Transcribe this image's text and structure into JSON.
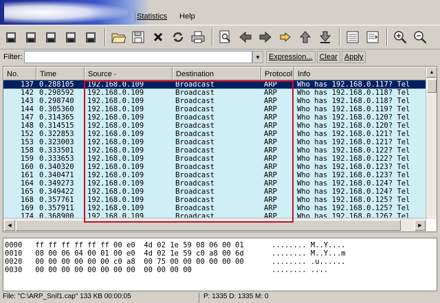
{
  "menu": [
    "Statistics",
    "Help"
  ],
  "toolbar": {
    "icons": [
      "disk-icon",
      "disk-icon",
      "disk-icon",
      "disk-icon",
      "disk-icon",
      "folder-open-icon",
      "save-icon",
      "close-icon",
      "reload-icon",
      "print-icon",
      "find-icon",
      "back-arrow-icon",
      "forward-arrow-icon",
      "goto-icon",
      "top-icon",
      "bottom-icon",
      "colorize-icon",
      "autoscroll-icon",
      "zoom-in-icon",
      "zoom-out-icon"
    ]
  },
  "filter": {
    "label": "Filter:",
    "value": "",
    "expression_label": "Expression...",
    "clear_label": "Clear",
    "apply_label": "Apply"
  },
  "packet_list": {
    "columns": [
      "No.",
      "Time",
      "Source",
      "Destination",
      "Protocol",
      "Info"
    ],
    "sort_indicator": "-",
    "rows": [
      {
        "no": "137",
        "time": "0.288105",
        "src": "192.168.0.109",
        "dst": "Broadcast",
        "proto": "ARP",
        "info": "Who has 192.168.0.117?  Tel",
        "selected": true
      },
      {
        "no": "142",
        "time": "0.298592",
        "src": "192.168.0.109",
        "dst": "Broadcast",
        "proto": "ARP",
        "info": "Who has 192.168.0.118?  Tel"
      },
      {
        "no": "143",
        "time": "0.298740",
        "src": "192.168.0.109",
        "dst": "Broadcast",
        "proto": "ARP",
        "info": "Who has 192.168.0.118?  Tel"
      },
      {
        "no": "144",
        "time": "0.305360",
        "src": "192.168.0.109",
        "dst": "Broadcast",
        "proto": "ARP",
        "info": "Who has 192.168.0.119?  Tel"
      },
      {
        "no": "147",
        "time": "0.314365",
        "src": "192.168.0.109",
        "dst": "Broadcast",
        "proto": "ARP",
        "info": "Who has 192.168.0.120?  Tel"
      },
      {
        "no": "148",
        "time": "0.314515",
        "src": "192.168.0.109",
        "dst": "Broadcast",
        "proto": "ARP",
        "info": "Who has 192.168.0.120?  Tel"
      },
      {
        "no": "152",
        "time": "0.322853",
        "src": "192.168.0.109",
        "dst": "Broadcast",
        "proto": "ARP",
        "info": "Who has 192.168.0.121?  Tel"
      },
      {
        "no": "153",
        "time": "0.323003",
        "src": "192.168.0.109",
        "dst": "Broadcast",
        "proto": "ARP",
        "info": "Who has 192.168.0.121?  Tel"
      },
      {
        "no": "158",
        "time": "0.333501",
        "src": "192.168.0.109",
        "dst": "Broadcast",
        "proto": "ARP",
        "info": "Who has 192.168.0.122?  Tel"
      },
      {
        "no": "159",
        "time": "0.333653",
        "src": "192.168.0.109",
        "dst": "Broadcast",
        "proto": "ARP",
        "info": "Who has 192.168.0.122?  Tel"
      },
      {
        "no": "160",
        "time": "0.340320",
        "src": "192.168.0.109",
        "dst": "Broadcast",
        "proto": "ARP",
        "info": "Who has 192.168.0.123?  Tel"
      },
      {
        "no": "161",
        "time": "0.340471",
        "src": "192.168.0.109",
        "dst": "Broadcast",
        "proto": "ARP",
        "info": "Who has 192.168.0.123?  Tel"
      },
      {
        "no": "164",
        "time": "0.349273",
        "src": "192.168.0.109",
        "dst": "Broadcast",
        "proto": "ARP",
        "info": "Who has 192.168.0.124?  Tel"
      },
      {
        "no": "165",
        "time": "0.349422",
        "src": "192.168.0.109",
        "dst": "Broadcast",
        "proto": "ARP",
        "info": "Who has 192.168.0.124?  Tel"
      },
      {
        "no": "168",
        "time": "0.357761",
        "src": "192.168.0.109",
        "dst": "Broadcast",
        "proto": "ARP",
        "info": "Who has 192.168.0.125?  Tel"
      },
      {
        "no": "169",
        "time": "0.357911",
        "src": "192.168.0.109",
        "dst": "Broadcast",
        "proto": "ARP",
        "info": "Who has 192.168.0.125?  Tel"
      },
      {
        "no": "174",
        "time": "0.368900",
        "src": "192.168.0.109",
        "dst": "Broadcast",
        "proto": "ARP",
        "info": "Who has 192.168.0.126?  Tel"
      }
    ]
  },
  "bytes_pane": {
    "lines": [
      {
        "offset": "0000",
        "hex": "ff ff ff ff ff ff 00 e0  4d 02 1e 59 08 06 00 01",
        "ascii": "........ M..Y...."
      },
      {
        "offset": "0010",
        "hex": "08 00 06 04 00 01 00 e0  4d 02 1e 59 c0 a8 00 6d",
        "ascii": "........ M..Y...m"
      },
      {
        "offset": "0020",
        "hex": "00 00 00 00 00 00 c0 a8  00 75 00 00 00 00 00 00",
        "ascii": "........ .u......"
      },
      {
        "offset": "0030",
        "hex": "00 00 00 00 00 00 00 00  00 00 00 00",
        "ascii": "........ ...."
      }
    ]
  },
  "status": {
    "file": "File: \"C:\\ARP_Snif1.cap\" 133 KB 00:00:05",
    "packets": "P: 1335 D: 1335 M: 0"
  },
  "colors": {
    "row_background": "#cfeef6",
    "selected_background": "#002060",
    "highlight_border": "#c8102e"
  }
}
